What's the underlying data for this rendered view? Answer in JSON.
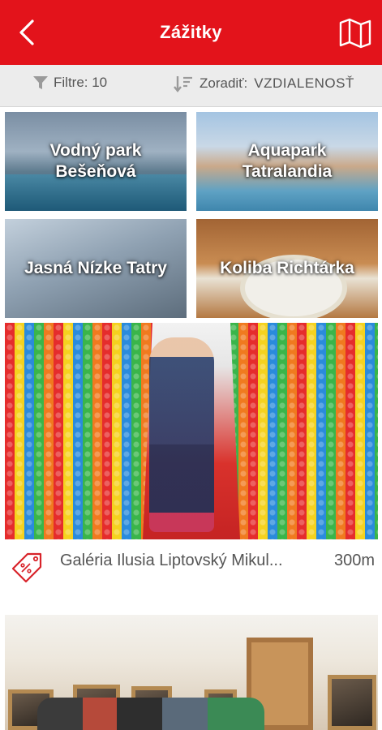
{
  "appbar": {
    "title": "Zážitky",
    "back_icon": "back-chevron-icon",
    "map_icon": "map-icon",
    "color": "#e3131b"
  },
  "filterbar": {
    "filter_label": "Filtre: 10",
    "sort_label": "Zoradiť:",
    "sort_value": "VZDIALENOSŤ"
  },
  "tiles": [
    {
      "label_line1": "Vodný park",
      "label_line2": "Bešeňová"
    },
    {
      "label_line1": "Aquapark",
      "label_line2": "Tatralandia"
    },
    {
      "label_line1": "Jasná Nízke Tatry",
      "label_line2": ""
    },
    {
      "label_line1": "Koliba Richtárka",
      "label_line2": ""
    }
  ],
  "cards": [
    {
      "name": "Galéria Ilusia Liptovský Mikul...",
      "distance": "300m",
      "icon": "discount-tag-icon"
    },
    {
      "name": "",
      "distance": ""
    }
  ]
}
